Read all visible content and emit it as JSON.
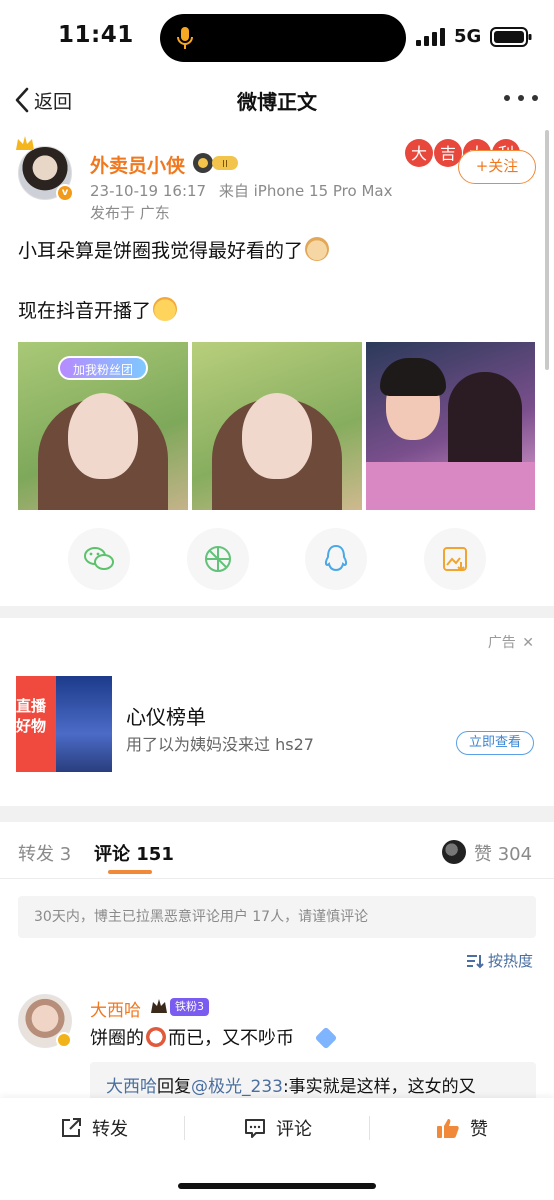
{
  "status_bar": {
    "time": "11:41",
    "network": "5G"
  },
  "nav": {
    "back_label": "返回",
    "title": "微博正文"
  },
  "post": {
    "username": "外卖员小侠",
    "level": "II",
    "timestamp": "23-10-19 16:17",
    "source": "来自 iPhone 15 Pro Max",
    "location": "发布于 广东",
    "fortune_text": "大吉大利",
    "follow_label": "+关注",
    "line1": "小耳朵算是饼圈我觉得最好看的了",
    "line2": "现在抖音开播了",
    "photo1_tag": "加我粉丝团"
  },
  "share_icons": [
    "wechat-icon",
    "moments-icon",
    "qq-icon",
    "save-image-icon"
  ],
  "ad": {
    "label": "广告",
    "thumb_text1": "直播",
    "thumb_text2": "好物",
    "title": "心仪榜单",
    "subtitle": "用了以为姨妈没来过 hs27",
    "cta": "立即查看"
  },
  "tabs": {
    "repost": "转发 3",
    "comments": "评论 151",
    "likes": "赞 304"
  },
  "notice": "30天内，博主已拉黑恶意评论用户 17人，请谨慎评论",
  "sort_label": "按热度",
  "comment": {
    "name": "大西哈",
    "fan_badge": "铁粉3",
    "text_before": "饼圈的",
    "text_after": "而已，又不吵币",
    "reply_author": "大西哈",
    "reply_verb": "回复",
    "reply_target": "@极光_233",
    "reply_text": ":事实就是这样，这女的又"
  },
  "bottom_bar": {
    "repost": "转发",
    "comment": "评论",
    "like": "赞"
  },
  "colors": {
    "accent": "#f0781e",
    "link": "#4a6fa0",
    "like": "#f08a3a"
  }
}
